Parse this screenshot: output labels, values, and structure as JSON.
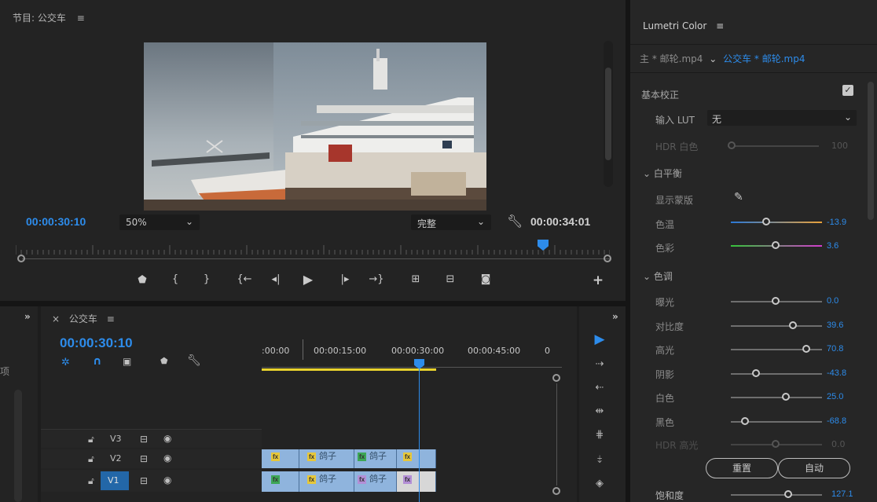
{
  "monitor": {
    "title": "节目: 公交车",
    "menu_icon": "≡",
    "current_time": "00:00:30:10",
    "zoom": "50%",
    "quality": "完整",
    "duration": "00:00:34:01",
    "playhead_fraction": 0.88
  },
  "lumetri": {
    "title": "Lumetri Color",
    "menu_icon": "≡",
    "source_clip": "主 * 邮轮.mp4",
    "target_clip": "公交车 * 邮轮.mp4",
    "basic_section": "基本校正",
    "input_lut_label": "输入 LUT",
    "input_lut_value": "无",
    "hdr_white_label": "HDR 白色",
    "hdr_white_value": "100",
    "white_balance": "白平衡",
    "show_mask": "显示蒙版",
    "temp_label": "色温",
    "temp_value": "-13.9",
    "tint_label": "色彩",
    "tint_value": "3.6",
    "tone_section": "色调",
    "tone": [
      {
        "label": "曝光",
        "value": "0.0",
        "pos": 0.5
      },
      {
        "label": "对比度",
        "value": "39.6",
        "pos": 0.7
      },
      {
        "label": "高光",
        "value": "70.8",
        "pos": 0.85
      },
      {
        "label": "阴影",
        "value": "-43.8",
        "pos": 0.28
      },
      {
        "label": "白色",
        "value": "25.0",
        "pos": 0.62
      },
      {
        "label": "黑色",
        "value": "-68.8",
        "pos": 0.15
      }
    ],
    "hdr_highlight_label": "HDR 高光",
    "hdr_highlight_value": "0.0",
    "reset_label": "重置",
    "auto_label": "自动",
    "saturation_label": "饱和度",
    "saturation_value": "127.1"
  },
  "timeline": {
    "seq_name": "公交车",
    "menu_icon": "≡",
    "timecode": "00:00:30:10",
    "ruler": [
      ":00:00",
      "00:00:15:00",
      "00:00:30:00",
      "00:00:45:00"
    ],
    "tracks": [
      "V3",
      "V2",
      "V1"
    ],
    "clip_label": "鸽子",
    "fx_label": "fx",
    "left_panel_label": "项",
    "expand_icon": "»",
    "close_icon": "×"
  }
}
